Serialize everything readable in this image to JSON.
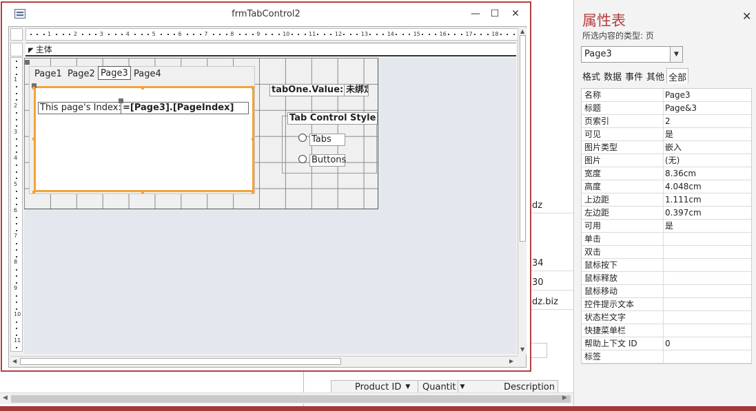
{
  "window": {
    "title": "frmTabControl2"
  },
  "section": {
    "label": "主体"
  },
  "tabs": [
    "Page1",
    "Page2",
    "Page3",
    "Page4"
  ],
  "tab_page": {
    "index_label": "This page's Index:",
    "index_expr": "=[Page3].[PageIndex]"
  },
  "tab_value": {
    "label": "tabOne.Value:",
    "textbox": "未绑定"
  },
  "style_group": {
    "label": "Tab Control Style",
    "option_tabs": "Tabs",
    "option_buttons": "Buttons"
  },
  "ruler": {
    "h_numbers": [
      "1",
      "2",
      "3",
      "4",
      "5",
      "6",
      "7",
      "8",
      "9",
      "10",
      "11",
      "12",
      "13",
      "14",
      "15",
      "16",
      "17",
      "18"
    ],
    "v_numbers": [
      "1",
      "2",
      "3",
      "4",
      "5",
      "6",
      "7",
      "8",
      "9",
      "10",
      "11"
    ]
  },
  "background": {
    "cells": [
      "dz",
      "34",
      "30",
      "dz.biz"
    ],
    "grid_headers": [
      "Product ID",
      "Quantit",
      "Description"
    ]
  },
  "properties": {
    "title": "属性表",
    "subtitle": "所选内容的类型: 页",
    "selected_object": "Page3",
    "tabs": [
      "格式",
      "数据",
      "事件",
      "其他",
      "全部"
    ],
    "active_tab": "全部",
    "rows": [
      {
        "k": "名称",
        "v": "Page3"
      },
      {
        "k": "标题",
        "v": "Page&3"
      },
      {
        "k": "页索引",
        "v": "2"
      },
      {
        "k": "可见",
        "v": "是"
      },
      {
        "k": "图片类型",
        "v": "嵌入"
      },
      {
        "k": "图片",
        "v": "(无)"
      },
      {
        "k": "宽度",
        "v": "8.36cm"
      },
      {
        "k": "高度",
        "v": "4.048cm"
      },
      {
        "k": "上边距",
        "v": "1.111cm"
      },
      {
        "k": "左边距",
        "v": "0.397cm"
      },
      {
        "k": "可用",
        "v": "是"
      },
      {
        "k": "单击",
        "v": ""
      },
      {
        "k": "双击",
        "v": ""
      },
      {
        "k": "鼠标按下",
        "v": ""
      },
      {
        "k": "鼠标释放",
        "v": ""
      },
      {
        "k": "鼠标移动",
        "v": ""
      },
      {
        "k": "控件提示文本",
        "v": ""
      },
      {
        "k": "状态栏文字",
        "v": ""
      },
      {
        "k": "快捷菜单栏",
        "v": ""
      },
      {
        "k": "帮助上下文 ID",
        "v": "0"
      },
      {
        "k": "标签",
        "v": ""
      }
    ]
  },
  "colors": {
    "accent": "#b53d3d",
    "selection": "#f2a33a"
  }
}
